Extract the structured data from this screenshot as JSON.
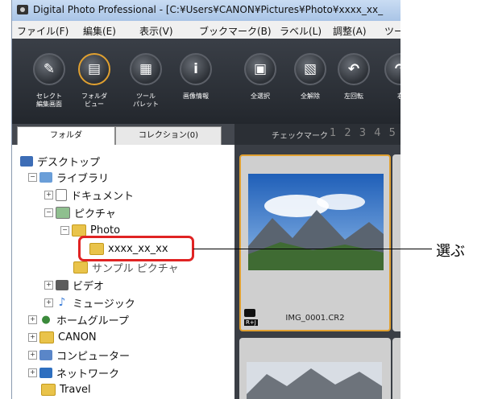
{
  "window": {
    "title": "Digital Photo Professional - [C:¥Users¥CANON¥Pictures¥Photo¥xxxx_xx_"
  },
  "menu": [
    "ファイル(F)",
    "編集(E)",
    "表示(V)",
    "ブックマーク(B)",
    "ラベル(L)",
    "調整(A)",
    "ツー"
  ],
  "toolbar": [
    {
      "label": "セレクト\n編集画面",
      "icon": "edit-icon"
    },
    {
      "label": "フォルダ\nビュー",
      "icon": "folder-view-icon",
      "active": true
    },
    {
      "label": "ツール\nパレット",
      "icon": "tool-palette-icon"
    },
    {
      "label": "画像情報",
      "icon": "info-icon"
    },
    {
      "label": "全選択",
      "icon": "select-all-icon"
    },
    {
      "label": "全解除",
      "icon": "deselect-all-icon"
    },
    {
      "label": "左回転",
      "icon": "rotate-left-icon"
    },
    {
      "label": "右",
      "icon": "rotate-right-icon"
    }
  ],
  "tabs": {
    "folder": "フォルダ",
    "collection": "コレクション(0)"
  },
  "checkmark": {
    "label": "チェックマーク",
    "numbers": "1 2 3 4 5"
  },
  "tree": {
    "desktop": "デスクトップ",
    "library": "ライブラリ",
    "documents": "ドキュメント",
    "pictures": "ピクチャ",
    "photo": "Photo",
    "selected_folder": "xxxx_xx_xx",
    "sample_pictures": "サンプル ピクチャ",
    "video": "ビデオ",
    "music": "ミュージック",
    "homegroup": "ホームグループ",
    "canon": "CANON",
    "computer": "コンピューター",
    "network": "ネットワーク",
    "travel": "Travel"
  },
  "thumbnails": [
    {
      "filename": "IMG_0001.CR2",
      "badge": "R+J"
    }
  ],
  "callout": "選ぶ",
  "colors": {
    "selection_highlight": "#e02323",
    "thumb_selected_border": "#e0a030"
  }
}
